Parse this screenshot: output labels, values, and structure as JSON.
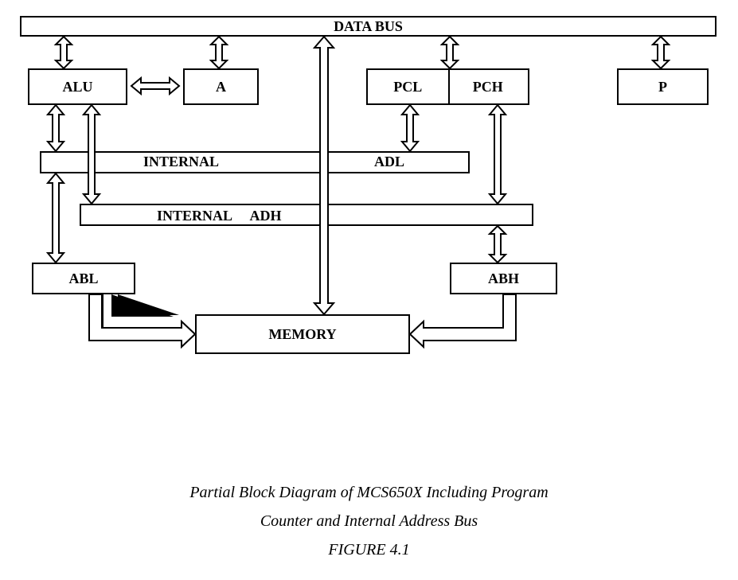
{
  "title": "DATA BUS",
  "blocks": {
    "alu": "ALU",
    "a": "A",
    "pcl": "PCL",
    "pch": "PCH",
    "p": "P",
    "internal_adl_internal": "INTERNAL",
    "internal_adl_adl": "ADL",
    "internal_adh": "INTERNAL  ADH",
    "abl": "ABL",
    "abh": "ABH",
    "memory": "MEMORY"
  },
  "caption_line1": "Partial Block Diagram of MCS650X Including Program",
  "caption_line2": "Counter and Internal Address Bus",
  "figure_number": "FIGURE 4.1"
}
